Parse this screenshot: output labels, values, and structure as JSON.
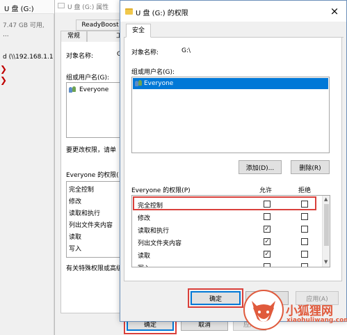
{
  "explorer": {
    "drive_title": "U 盘 (G:)",
    "drive_info": "7.47 GB 可用,",
    "ellipsis": "...",
    "network_path": "d (\\\\192.168.1.1"
  },
  "props_dialog": {
    "title": "U 盘 (G:) 属性",
    "tab_readyboost": "ReadyBoost",
    "tab_general": "常规",
    "tab_tools": "工",
    "object_label": "对象名称:",
    "object_value_partial": "G",
    "group_label": "组或用户名(G):",
    "user_everyone": "Everyone",
    "change_perm_text": "要更改权限，请单",
    "perm_header": "Everyone 的权限(",
    "perm_items": [
      "完全控制",
      "修改",
      "读取和执行",
      "列出文件夹内容",
      "读取",
      "写入"
    ],
    "special_text": "有关特殊权限或高级",
    "ok_label": "确定",
    "cancel_label": "取消",
    "apply_label": "应用"
  },
  "perm_dialog": {
    "title": "U 盘 (G:) 的权限",
    "close_label": "×",
    "tab_security": "安全",
    "object_label": "对象名称:",
    "object_value": "G:\\",
    "group_label": "组或用户名(G):",
    "selected_user": "Everyone",
    "add_label": "添加(D)...",
    "remove_label": "删除(R)",
    "perm_header": "Everyone 的权限(P)",
    "allow_header": "允许",
    "deny_header": "拒绝",
    "rows": [
      {
        "name": "完全控制",
        "allow": false,
        "deny": false
      },
      {
        "name": "修改",
        "allow": false,
        "deny": false
      },
      {
        "name": "读取和执行",
        "allow": true,
        "deny": false
      },
      {
        "name": "列出文件夹内容",
        "allow": true,
        "deny": false
      },
      {
        "name": "读取",
        "allow": true,
        "deny": false
      },
      {
        "name": "写入",
        "allow": false,
        "deny": false
      }
    ],
    "check_glyph": "✓",
    "ok_label": "确定",
    "cancel_label": "取消",
    "apply_label": "应用(A)"
  },
  "watermark": {
    "brand_cn": "小狐狸网",
    "brand_site": "xiaohuliwang.com"
  },
  "colors": {
    "highlight_border": "#d9403b",
    "selection_blue": "#0078d7",
    "watermark_orange": "#e05a3c"
  }
}
